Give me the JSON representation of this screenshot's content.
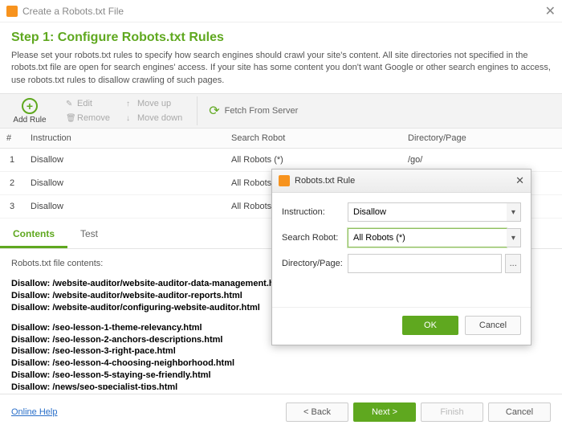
{
  "window": {
    "title": "Create a Robots.txt File"
  },
  "step": {
    "heading": "Step 1: Configure Robots.txt Rules",
    "intro": "Please set your robots.txt rules to specify how search engines should crawl your site's content. All site directories not specified in the robots.txt file are open for search engines' access. If your site has some content you don't want Google or other search engines to access, use robots.txt rules to disallow crawling of such pages."
  },
  "toolbar": {
    "add_rule": "Add Rule",
    "edit": "Edit",
    "remove": "Remove",
    "move_up": "Move up",
    "move_down": "Move down",
    "fetch": "Fetch From Server"
  },
  "table": {
    "headers": {
      "num": "#",
      "instruction": "Instruction",
      "robot": "Search Robot",
      "dir": "Directory/Page"
    },
    "rows": [
      {
        "num": "1",
        "instruction": "Disallow",
        "robot": "All Robots (*)",
        "dir": "/go/"
      },
      {
        "num": "2",
        "instruction": "Disallow",
        "robot": "All Robots (*)",
        "dir": ""
      },
      {
        "num": "3",
        "instruction": "Disallow",
        "robot": "All Robots",
        "dir": ""
      }
    ]
  },
  "tabs": {
    "contents": "Contents",
    "test": "Test"
  },
  "contents": {
    "header": "Robots.txt file contents:",
    "lines": [
      "Disallow: /website-auditor/website-auditor-data-management.html",
      "Disallow: /website-auditor/website-auditor-reports.html",
      "Disallow: /website-auditor/configuring-website-auditor.html",
      "",
      "Disallow: /seo-lesson-1-theme-relevancy.html",
      "Disallow: /seo-lesson-2-anchors-descriptions.html",
      "Disallow: /seo-lesson-3-right-pace.html",
      "Disallow: /seo-lesson-4-choosing-neighborhood.html",
      "Disallow: /seo-lesson-5-staying-se-friendly.html",
      "Disallow: /news/seo-specialist-tips.html"
    ]
  },
  "footer": {
    "help": "Online Help",
    "back": "< Back",
    "next": "Next >",
    "finish": "Finish",
    "cancel": "Cancel"
  },
  "modal": {
    "title": "Robots.txt Rule",
    "labels": {
      "instruction": "Instruction:",
      "robot": "Search Robot:",
      "dir": "Directory/Page:"
    },
    "values": {
      "instruction": "Disallow",
      "robot": "All Robots (*)",
      "dir": ""
    },
    "browse": "...",
    "ok": "OK",
    "cancel": "Cancel"
  }
}
